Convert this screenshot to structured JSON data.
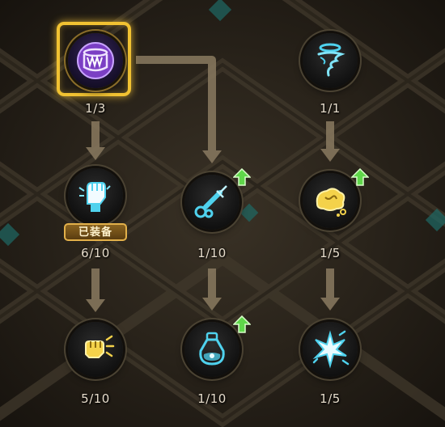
{
  "skill_tree": {
    "nodes": [
      {
        "level": "1/3",
        "icon": "purple-rune-icon",
        "selected": true,
        "upgradable": false,
        "badge": ""
      },
      {
        "level": "1/1",
        "icon": "halo-tornado-icon",
        "selected": false,
        "upgradable": false,
        "badge": ""
      },
      {
        "level": "6/10",
        "icon": "raised-fist-icon",
        "selected": false,
        "upgradable": false,
        "badge": "已装备"
      },
      {
        "level": "1/10",
        "icon": "syringe-icon",
        "selected": false,
        "upgradable": true,
        "badge": ""
      },
      {
        "level": "1/5",
        "icon": "dizzy-brain-icon",
        "selected": false,
        "upgradable": true,
        "badge": ""
      },
      {
        "level": "5/10",
        "icon": "punch-impact-icon",
        "selected": false,
        "upgradable": false,
        "badge": ""
      },
      {
        "level": "1/10",
        "icon": "potion-flask-icon",
        "selected": false,
        "upgradable": true,
        "badge": ""
      },
      {
        "level": "1/5",
        "icon": "shatter-burst-icon",
        "selected": false,
        "upgradable": false,
        "badge": ""
      }
    ]
  },
  "colors": {
    "icon_yellow": "#f4d24a",
    "icon_cyan": "#4fd2ee",
    "selected_frame": "#f1c232",
    "upgrade_arrow": "#5fd64a",
    "level_text": "#e6dccb",
    "connector": "#8a7a60",
    "background": "#241f18"
  }
}
